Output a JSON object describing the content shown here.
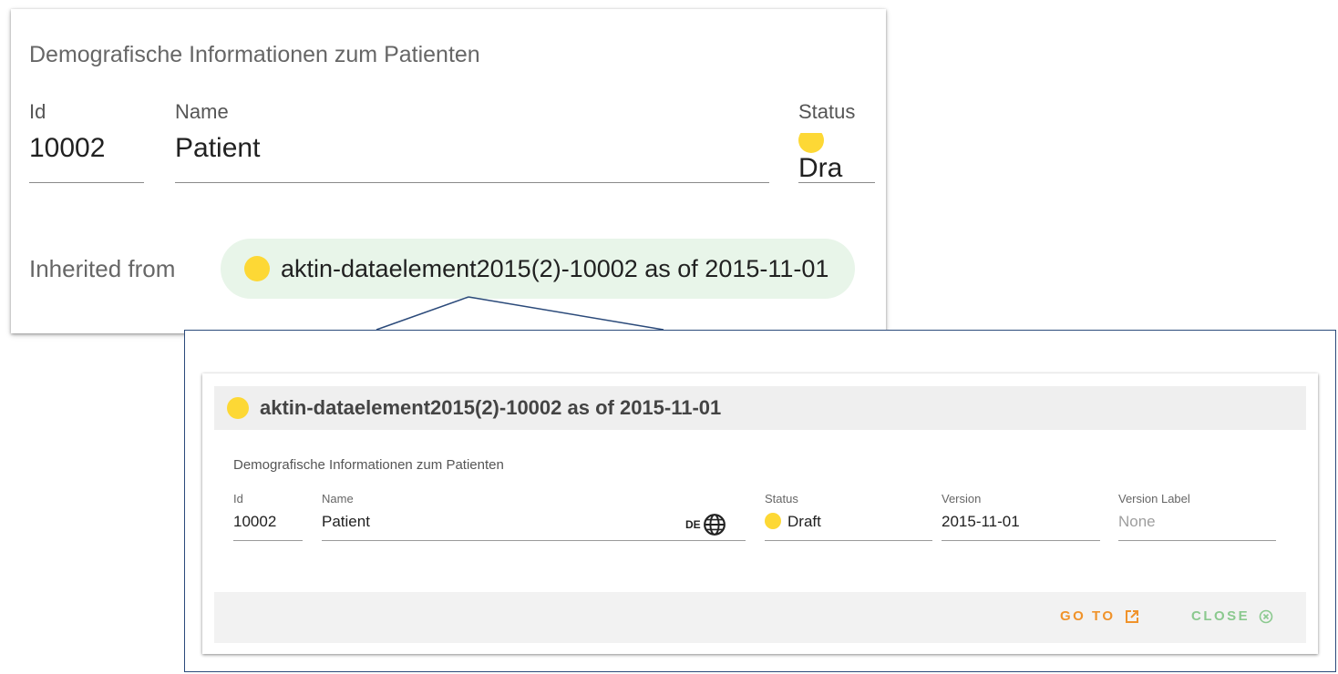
{
  "card": {
    "description": "Demografische Informationen zum Patienten",
    "id_label": "Id",
    "id_value": "10002",
    "name_label": "Name",
    "name_value": "Patient",
    "status_label": "Status",
    "status_value": "Dra",
    "inherited_label": "Inherited from",
    "inherited_value": "aktin-dataelement2015(2)-10002 as of 2015-11-01"
  },
  "popup": {
    "title": "aktin-dataelement2015(2)-10002 as of 2015-11-01",
    "description": "Demografische Informationen zum Patienten",
    "id_label": "Id",
    "id_value": "10002",
    "name_label": "Name",
    "name_value": "Patient",
    "language_code": "DE",
    "status_label": "Status",
    "status_value": "Draft",
    "version_label": "Version",
    "version_value": "2015-11-01",
    "version_label_label": "Version Label",
    "version_label_placeholder": "None",
    "goto_label": "GO TO",
    "close_label": "CLOSE"
  },
  "colors": {
    "status_draft": "#fdd835",
    "chip_background": "#e8f5e9",
    "goto": "#f0932b",
    "close": "#8bc98f",
    "callout_border": "#2b4a7a"
  },
  "icons": {
    "status": "status-dot-icon",
    "language": "globe-icon",
    "goto": "open-in-new-icon",
    "close": "close-circle-icon"
  }
}
